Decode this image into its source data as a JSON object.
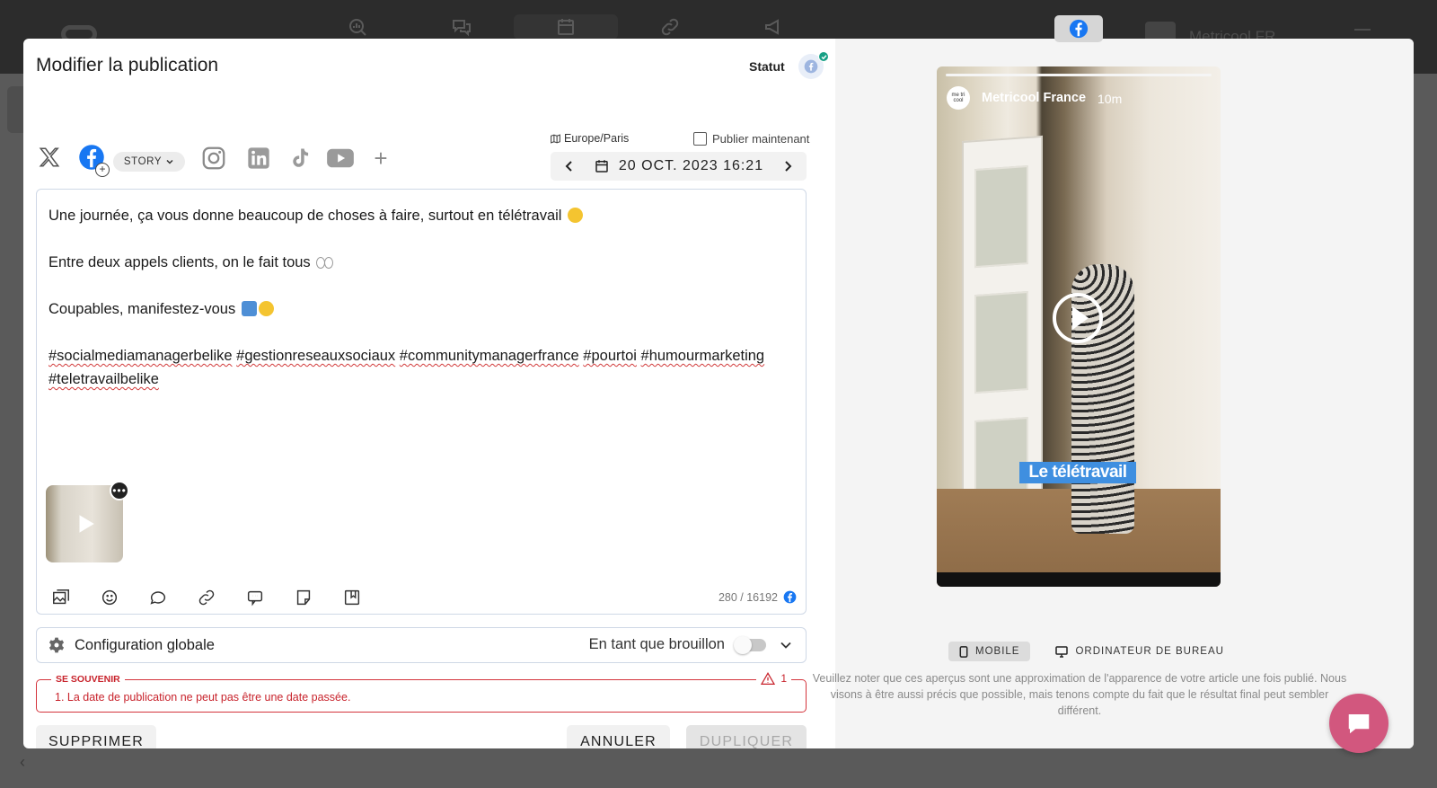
{
  "background": {
    "account_name": "Metricool FR"
  },
  "modal": {
    "title": "Modifier la publication",
    "status_label": "Statut"
  },
  "networks": {
    "items": [
      {
        "name": "x-twitter",
        "active": false
      },
      {
        "name": "facebook",
        "active": true
      },
      {
        "name": "instagram",
        "active": false
      },
      {
        "name": "linkedin",
        "active": false
      },
      {
        "name": "tiktok",
        "active": false
      },
      {
        "name": "youtube",
        "active": false
      }
    ],
    "story_label": "STORY",
    "add_label": "+"
  },
  "schedule": {
    "timezone": "Europe/Paris",
    "publish_now_label": "Publier maintenant",
    "date": "20 OCT. 2023 16:21"
  },
  "editor": {
    "line1": "Une journée, ça vous donne beaucoup de choses à faire, surtout en télétravail",
    "line2": "Entre deux appels clients, on le fait tous",
    "line3": "Coupables, manifestez-vous",
    "hashtags": [
      "#socialmediamanagerbelike",
      "#gestionreseauxsociaux",
      "#communitymanagerfrance",
      "#pourtoi",
      "#humourmarketing",
      "#teletravailbelike"
    ],
    "char_count": "280 / 16192",
    "toolbar": [
      "media-icon",
      "emoji-icon",
      "comment-icon",
      "link-icon",
      "chatbot-icon",
      "note-icon",
      "template-icon"
    ]
  },
  "config": {
    "title": "Configuration globale",
    "draft_label": "En tant que brouillon"
  },
  "reminder": {
    "title": "SE SOUVENIR",
    "count": "1",
    "message": "1. La date de publication ne peut pas être une date passée."
  },
  "buttons": {
    "delete": "SUPPRIMER",
    "cancel": "ANNULER",
    "duplicate": "DUPLIQUER"
  },
  "preview": {
    "account": "Metricool France",
    "time": "10m",
    "avatar_text": "me tri cool",
    "caption": "Le télétravail",
    "view_mobile": "MOBILE",
    "view_desktop": "ORDINATEUR DE BUREAU",
    "note": "Veuillez noter que ces aperçus sont une approximation de l'apparence de votre article une fois publié. Nous visons à être aussi précis que possible, mais tenons compte du fait que le résultat final peut sembler différent."
  },
  "colors": {
    "facebook": "#1877f2",
    "error": "#c8232c",
    "chat": "#d2577e"
  }
}
